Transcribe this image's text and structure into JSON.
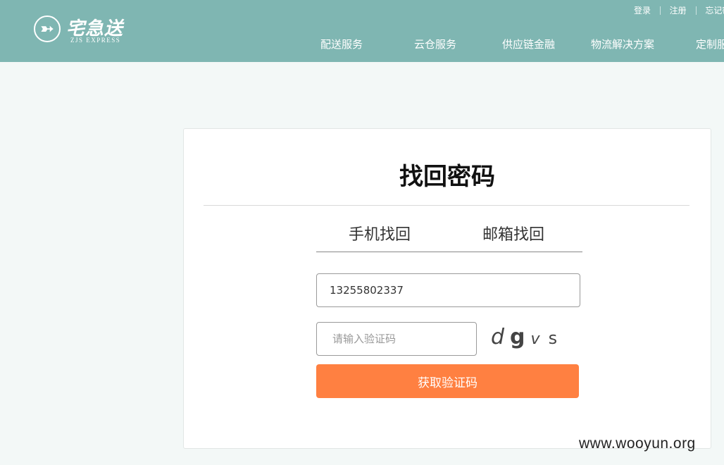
{
  "header": {
    "logo_text": "宅急送",
    "logo_subtitle": "ZJS EXPRESS",
    "top_links": [
      "登录",
      "注册",
      "忘记密码"
    ],
    "nav": [
      "配送服务",
      "云仓服务",
      "供应链金融",
      "物流解决方案",
      "定制服务"
    ]
  },
  "form": {
    "title": "找回密码",
    "tabs": [
      "手机找回",
      "邮箱找回"
    ],
    "phone_value": "13255802337",
    "code_placeholder": "请输入验证码",
    "captcha": [
      "d",
      "g",
      "v",
      "s"
    ],
    "get_code_label": "获取验证码"
  },
  "watermark": "www.wooyun.org",
  "colors": {
    "header_bg": "#7fb6b2",
    "page_bg": "#f3f8f7",
    "primary_button": "#ff8041"
  }
}
